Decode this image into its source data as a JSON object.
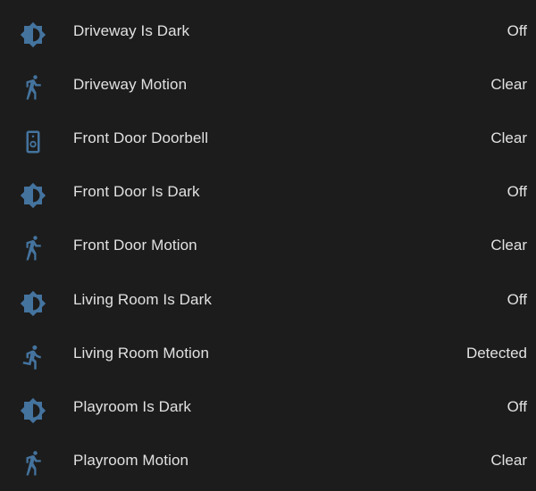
{
  "theme": {
    "background": "#1c1c1c",
    "icon_color": "#44739e",
    "text_color": "#e1e1e1"
  },
  "entities": [
    {
      "icon": "brightness-icon",
      "name": "Driveway Is Dark",
      "state": "Off"
    },
    {
      "icon": "walk-icon",
      "name": "Driveway Motion",
      "state": "Clear"
    },
    {
      "icon": "doorbell-icon",
      "name": "Front Door Doorbell",
      "state": "Clear"
    },
    {
      "icon": "brightness-icon",
      "name": "Front Door Is Dark",
      "state": "Off"
    },
    {
      "icon": "walk-icon",
      "name": "Front Door Motion",
      "state": "Clear"
    },
    {
      "icon": "brightness-icon",
      "name": "Living Room Is Dark",
      "state": "Off"
    },
    {
      "icon": "run-icon",
      "name": "Living Room Motion",
      "state": "Detected"
    },
    {
      "icon": "brightness-icon",
      "name": "Playroom Is Dark",
      "state": "Off"
    },
    {
      "icon": "walk-icon",
      "name": "Playroom Motion",
      "state": "Clear"
    }
  ]
}
